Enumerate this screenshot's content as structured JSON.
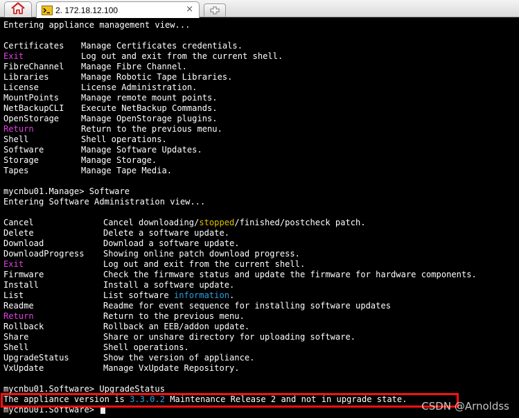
{
  "tabbar": {
    "home_icon": "home-icon",
    "tab_title": "2. 172.18.12.100",
    "tab_icon": "ssh-session-icon",
    "close_glyph": "×",
    "new_tab_icon": "new-tab-icon"
  },
  "terminal": {
    "intro": "Entering appliance management view...",
    "manage_menu": [
      {
        "cmd": "Certificates",
        "desc": "Manage Certificates credentials."
      },
      {
        "cmd": "Exit",
        "desc": "Log out and exit from the current shell."
      },
      {
        "cmd": "FibreChannel",
        "desc": "Manage Fibre Channel."
      },
      {
        "cmd": "Libraries",
        "desc": "Manage Robotic Tape Libraries."
      },
      {
        "cmd": "License",
        "desc": "License Administration."
      },
      {
        "cmd": "MountPoints",
        "desc": "Manage remote mount points."
      },
      {
        "cmd": "NetBackupCLI",
        "desc": "Execute NetBackup Commands."
      },
      {
        "cmd": "OpenStorage",
        "desc": "Manage OpenStorage plugins."
      },
      {
        "cmd": "Return",
        "desc": "Return to the previous menu."
      },
      {
        "cmd": "Shell",
        "desc": "Shell operations."
      },
      {
        "cmd": "Software",
        "desc": "Manage Software Updates."
      },
      {
        "cmd": "Storage",
        "desc": "Manage Storage."
      },
      {
        "cmd": "Tapes",
        "desc": "Manage Tape Media."
      }
    ],
    "prompt1": "mycnbu01.Manage> Software",
    "software_intro": "Entering Software Administration view...",
    "cancel_cmd": "Cancel",
    "cancel_pre": "Cancel downloading/",
    "cancel_stopped": "stopped",
    "cancel_post": "/finished/postcheck patch.",
    "software_menu_a": [
      {
        "cmd": "Delete",
        "desc": "Delete a software update."
      },
      {
        "cmd": "Download",
        "desc": "Download a software update."
      },
      {
        "cmd": "DownloadProgress",
        "desc": "Showing online patch download progress."
      },
      {
        "cmd": "Exit",
        "desc": "Log out and exit from the current shell."
      },
      {
        "cmd": "Firmware",
        "desc": "Check the firmware status and update the firmware for hardware components."
      },
      {
        "cmd": "Install",
        "desc": "Install a software update."
      }
    ],
    "list_cmd": "List",
    "list_pre": "List software ",
    "list_info": "information",
    "list_post": ".",
    "software_menu_b": [
      {
        "cmd": "Readme",
        "desc": "Readme for event sequence for installing software updates"
      },
      {
        "cmd": "Return",
        "desc": "Return to the previous menu."
      },
      {
        "cmd": "Rollback",
        "desc": "Rollback an EEB/addon update."
      },
      {
        "cmd": "Share",
        "desc": "Share or unshare directory for uploading software."
      },
      {
        "cmd": "Shell",
        "desc": "Shell operations."
      },
      {
        "cmd": "UpgradeStatus",
        "desc": "Show the version of appliance."
      },
      {
        "cmd": "VxUpdate",
        "desc": "Manage VxUpdate Repository."
      }
    ],
    "prompt2": "mycnbu01.Software> UpgradeStatus",
    "version_pre": "The appliance version is ",
    "version_value": "3.3.0.2",
    "version_post": " Maintenance Release 2 and not in upgrade state.",
    "prompt3": "mycnbu01.Software> ",
    "watermark": "CSDN @Arnoldss"
  },
  "colors": {
    "highlight_cmd": "#e040e0",
    "stopped": "#e0c000",
    "info": "#2aa0e0",
    "annotation_box": "#ff1010"
  }
}
